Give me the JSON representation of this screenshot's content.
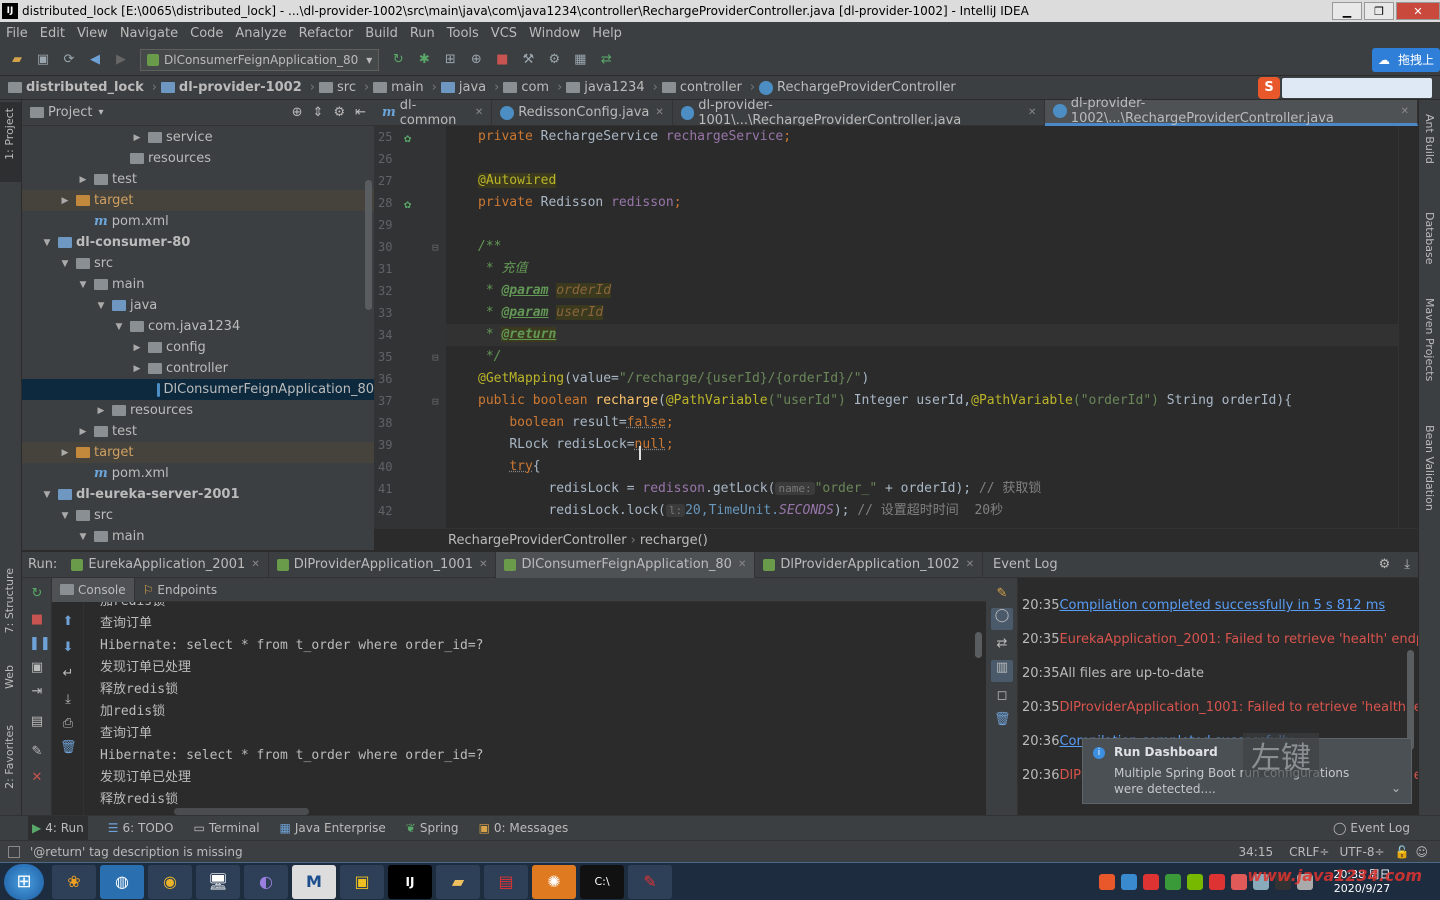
{
  "window": {
    "title": "distributed_lock [E:\\0065\\distributed_lock] - ...\\dl-provider-1002\\src\\main\\java\\com\\java1234\\controller\\RechargeProviderController.java [dl-provider-1002] - IntelliJ IDEA"
  },
  "menu": [
    "File",
    "Edit",
    "View",
    "Navigate",
    "Code",
    "Analyze",
    "Refactor",
    "Build",
    "Run",
    "Tools",
    "VCS",
    "Window",
    "Help"
  ],
  "toolbar": {
    "run_config": "DlConsumerFeignApplication_80"
  },
  "breadcrumbs": [
    "distributed_lock",
    "dl-provider-1002",
    "src",
    "main",
    "java",
    "com",
    "java1234",
    "controller",
    "RechargeProviderController"
  ],
  "ime": {
    "button": "拖拽上"
  },
  "project": {
    "title": "Project",
    "items": [
      {
        "label": "service",
        "depth": 6,
        "arrow": "▶",
        "icon": "folder",
        "bold": false
      },
      {
        "label": "resources",
        "depth": 5,
        "arrow": "",
        "icon": "folder",
        "bold": false
      },
      {
        "label": "test",
        "depth": 3,
        "arrow": "▶",
        "icon": "folder",
        "bold": false
      },
      {
        "label": "target",
        "depth": 2,
        "arrow": "▶",
        "icon": "folder-orange",
        "bold": false
      },
      {
        "label": "pom.xml",
        "depth": 3,
        "arrow": "",
        "icon": "m",
        "bold": false
      },
      {
        "label": "dl-consumer-80",
        "depth": 1,
        "arrow": "▼",
        "icon": "folder-blue",
        "bold": true
      },
      {
        "label": "src",
        "depth": 2,
        "arrow": "▼",
        "icon": "folder",
        "bold": false
      },
      {
        "label": "main",
        "depth": 3,
        "arrow": "▼",
        "icon": "folder",
        "bold": false
      },
      {
        "label": "java",
        "depth": 4,
        "arrow": "▼",
        "icon": "folder-blue",
        "bold": false
      },
      {
        "label": "com.java1234",
        "depth": 5,
        "arrow": "▼",
        "icon": "folder",
        "bold": false
      },
      {
        "label": "config",
        "depth": 6,
        "arrow": "▶",
        "icon": "folder",
        "bold": false
      },
      {
        "label": "controller",
        "depth": 6,
        "arrow": "▶",
        "icon": "folder",
        "bold": false
      },
      {
        "label": "DlConsumerFeignApplication_80",
        "depth": 7,
        "arrow": "",
        "icon": "class",
        "bold": false,
        "selected": true
      },
      {
        "label": "resources",
        "depth": 4,
        "arrow": "▶",
        "icon": "folder",
        "bold": false
      },
      {
        "label": "test",
        "depth": 3,
        "arrow": "▶",
        "icon": "folder",
        "bold": false
      },
      {
        "label": "target",
        "depth": 2,
        "arrow": "▶",
        "icon": "folder-orange",
        "bold": false
      },
      {
        "label": "pom.xml",
        "depth": 3,
        "arrow": "",
        "icon": "m",
        "bold": false
      },
      {
        "label": "dl-eureka-server-2001",
        "depth": 1,
        "arrow": "▼",
        "icon": "folder-blue",
        "bold": true
      },
      {
        "label": "src",
        "depth": 2,
        "arrow": "▼",
        "icon": "folder",
        "bold": false
      },
      {
        "label": "main",
        "depth": 3,
        "arrow": "▼",
        "icon": "folder",
        "bold": false
      }
    ]
  },
  "editor_tabs": [
    {
      "label": "dl-common",
      "active": false
    },
    {
      "label": "RedissonConfig.java",
      "active": false
    },
    {
      "label": "dl-provider-1001\\...\\RechargeProviderController.java",
      "active": false
    },
    {
      "label": "dl-provider-1002\\...\\RechargeProviderController.java",
      "active": true
    }
  ],
  "line_numbers": [
    "25",
    "26",
    "27",
    "28",
    "29",
    "30",
    "31",
    "32",
    "33",
    "34",
    "35",
    "36",
    "37",
    "38",
    "39",
    "40",
    "41",
    "42"
  ],
  "code": {
    "l25": {
      "kw": "private ",
      "type": "RechargeService ",
      "field": "rechargeService",
      "end": ";"
    },
    "l27": {
      "ann": "@Autowired"
    },
    "l28": {
      "kw": "private ",
      "type": "Redisson ",
      "field": "redisson",
      "end": ";"
    },
    "l30": "/**",
    "l31": "* 充值",
    "l32": {
      "star": "* ",
      "tag": "@param",
      "param": "orderId"
    },
    "l33": {
      "star": "* ",
      "tag": "@param",
      "param": "userId"
    },
    "l34": {
      "star": "* ",
      "tag": "@return"
    },
    "l35": "*/",
    "l36": {
      "ann": "@GetMapping",
      "open": "(value=",
      "str": "\"/recharge/{userId}/{orderId}/\"",
      "close": ")"
    },
    "l37": {
      "kw1": "public boolean ",
      "name": "recharge",
      "p1": "(",
      "ann1": "@PathVariable",
      "s1": "(\"userId\")",
      "t1": " Integer userId,",
      "ann2": "@PathVariable",
      "s2": "(\"orderId\")",
      "t2": " String orderId){"
    },
    "l38": {
      "kw": "boolean ",
      "text": "result=",
      "val": "false",
      "end": ";"
    },
    "l39": {
      "text": "RLock redisLock=",
      "val": "null",
      "end": ";"
    },
    "l40": {
      "kw": "try",
      "end": "{"
    },
    "l41": {
      "text": "redisLock = ",
      "field": "redisson",
      "call": ".getLock(",
      "hint": "name:",
      "str": "\"order_\"",
      "rest": " + orderId); ",
      "cmt": "// 获取锁"
    },
    "l42": {
      "text": "redisLock.lock(",
      "hint": "l:",
      "num": "20,TimeUnit.",
      "const": "SECONDS",
      "rest": "); ",
      "cmt": "// 设置超时时间  20秒"
    }
  },
  "editor_breadcrumb": [
    "RechargeProviderController",
    "recharge()"
  ],
  "run": {
    "label": "Run:",
    "tabs": [
      {
        "label": "EurekaApplication_2001",
        "active": false
      },
      {
        "label": "DlProviderApplication_1001",
        "active": false
      },
      {
        "label": "DlConsumerFeignApplication_80",
        "active": true
      },
      {
        "label": "DlProviderApplication_1002",
        "active": false
      }
    ],
    "subtabs": [
      "Console",
      "Endpoints"
    ],
    "console_lines": [
      "加redis锁",
      "查询订单",
      "Hibernate: select * from t_order where order_id=?",
      "发现订单已处理",
      "释放redis锁",
      "加redis锁",
      "查询订单",
      "Hibernate: select * from t_order where order_id=?",
      "发现订单已处理",
      "释放redis锁"
    ]
  },
  "event_log": {
    "title": "Event Log",
    "entries": [
      {
        "time": "20:35",
        "text": "Compilation completed successfully in 5 s 812 ms",
        "kind": "link"
      },
      {
        "time": "20:35",
        "text": "EurekaApplication_2001: Failed to retrieve 'health' endpoint data",
        "kind": "error"
      },
      {
        "time": "20:35",
        "text": "All files are up-to-date",
        "kind": "normal"
      },
      {
        "time": "20:35",
        "text": "DlProviderApplication_1001: Failed to retrieve 'health' endpoint data",
        "kind": "error"
      },
      {
        "time": "20:36",
        "text": "Compilation completed successfully",
        "kind": "link"
      },
      {
        "time": "20:36",
        "text": "DlProviderApplication_1002: Failed to retrieve 'health' endpoint data",
        "kind": "error"
      }
    ],
    "balloon": {
      "title": "Run Dashboard",
      "body": "Multiple Spring Boot run configurations were detected....",
      "overlay": "左键"
    }
  },
  "tool_windows": [
    "4: Run",
    "6: TODO",
    "Terminal",
    "Java Enterprise",
    "Spring",
    "0: Messages"
  ],
  "tool_windows_right": "Event Log",
  "status": {
    "message": "'@return' tag description is missing",
    "position": "34:15",
    "line_sep": "CRLF÷",
    "encoding": "UTF-8÷"
  },
  "side_labels": {
    "left": [
      "1: Project",
      "7: Structure",
      "Web",
      "2: Favorites"
    ],
    "right": [
      "Ant Build",
      "Database",
      "Maven Projects",
      "Bean Validation"
    ]
  },
  "taskbar": {
    "time": "20:38 周日",
    "date": "2020/9/27",
    "watermark": "www.java1234.com"
  },
  "colors": {
    "accent": "#4a88c7",
    "error": "#d8544d",
    "link": "#589df6"
  }
}
